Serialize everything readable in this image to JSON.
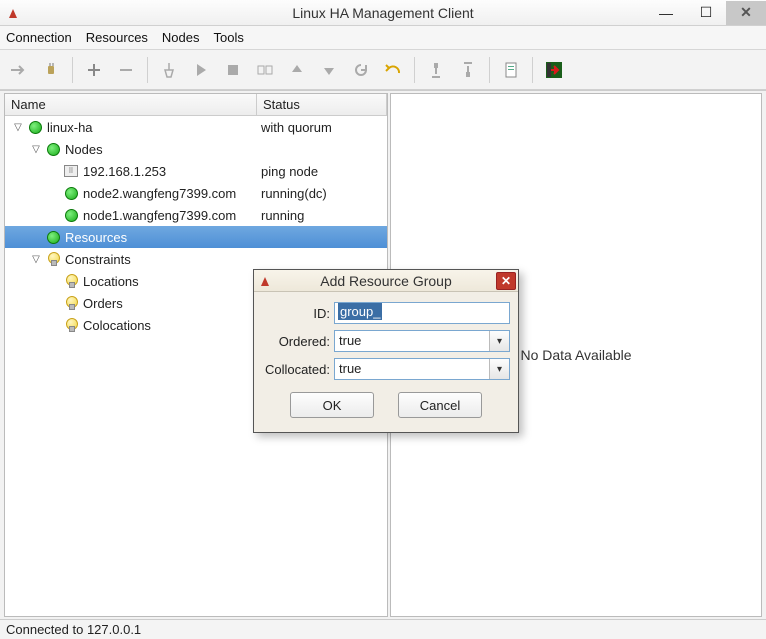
{
  "window": {
    "title": "Linux HA Management Client"
  },
  "menu": {
    "items": [
      "Connection",
      "Resources",
      "Nodes",
      "Tools"
    ]
  },
  "tree": {
    "columns": {
      "name": "Name",
      "status": "Status"
    },
    "rows": [
      {
        "indent": 0,
        "expander": "▽",
        "icon": "green",
        "label": "linux-ha",
        "status": "with quorum",
        "selected": false
      },
      {
        "indent": 1,
        "expander": "▽",
        "icon": "green",
        "label": "Nodes",
        "status": "",
        "selected": false
      },
      {
        "indent": 2,
        "expander": "",
        "icon": "ip",
        "label": "192.168.1.253",
        "status": "ping node",
        "selected": false
      },
      {
        "indent": 2,
        "expander": "",
        "icon": "green",
        "label": "node2.wangfeng7399.com",
        "status": "running(dc)",
        "selected": false
      },
      {
        "indent": 2,
        "expander": "",
        "icon": "green",
        "label": "node1.wangfeng7399.com",
        "status": "running",
        "selected": false
      },
      {
        "indent": 1,
        "expander": "",
        "icon": "green",
        "label": "Resources",
        "status": "",
        "selected": true
      },
      {
        "indent": 1,
        "expander": "▽",
        "icon": "bulb",
        "label": "Constraints",
        "status": "",
        "selected": false
      },
      {
        "indent": 2,
        "expander": "",
        "icon": "bulb",
        "label": "Locations",
        "status": "",
        "selected": false
      },
      {
        "indent": 2,
        "expander": "",
        "icon": "bulb",
        "label": "Orders",
        "status": "",
        "selected": false
      },
      {
        "indent": 2,
        "expander": "",
        "icon": "bulb",
        "label": "Colocations",
        "status": "",
        "selected": false
      }
    ]
  },
  "detail": {
    "empty_text": "No Data Available"
  },
  "dialog": {
    "title": "Add Resource Group",
    "fields": {
      "id": {
        "label": "ID:",
        "value": "group_"
      },
      "ordered": {
        "label": "Ordered:",
        "value": "true"
      },
      "collocated": {
        "label": "Collocated:",
        "value": "true"
      }
    },
    "buttons": {
      "ok": "OK",
      "cancel": "Cancel"
    }
  },
  "statusbar": {
    "text": "Connected to 127.0.0.1"
  }
}
